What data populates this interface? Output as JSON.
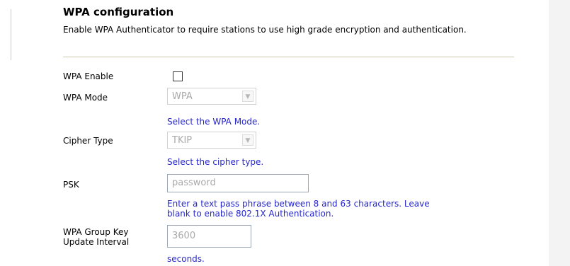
{
  "section": {
    "title": "WPA configuration",
    "description": "Enable WPA Authenticator to require stations to use high grade encryption and authentication."
  },
  "fields": {
    "wpa_enable": {
      "label": "WPA Enable",
      "checked": false
    },
    "wpa_mode": {
      "label": "WPA Mode",
      "value": "WPA",
      "hint": "Select the WPA Mode."
    },
    "cipher_type": {
      "label": "Cipher Type",
      "value": "TKIP",
      "hint": "Select the cipher type."
    },
    "psk": {
      "label": "PSK",
      "placeholder": "password",
      "hint_line1": "Enter a text pass phrase between 8 and 63 characters. Leave",
      "hint_line2": "blank to enable 802.1X Authentication."
    },
    "group_key": {
      "label_line1": "WPA Group Key",
      "label_line2": "Update Interval",
      "value": "3600",
      "hint": "seconds."
    }
  }
}
